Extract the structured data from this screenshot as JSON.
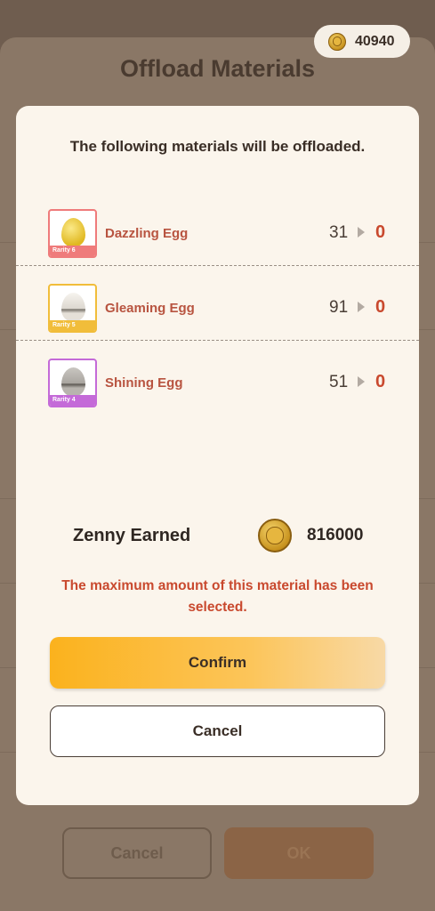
{
  "background": {
    "title": "Offload Materials",
    "cancel_label": "Cancel",
    "ok_label": "OK"
  },
  "wallet": {
    "coins": "40940",
    "icon": "zenny-coin-icon"
  },
  "dialog": {
    "heading": "The following materials will be offloaded.",
    "materials": [
      {
        "name": "Dazzling Egg",
        "rarity": "Rarity 6",
        "from": "31",
        "to": "0",
        "color": "#ef7b7b",
        "egg_color": "#f2d24a"
      },
      {
        "name": "Gleaming Egg",
        "rarity": "Rarity 5",
        "from": "91",
        "to": "0",
        "color": "#f1bd3a",
        "egg_color": "#efeae2"
      },
      {
        "name": "Shining Egg",
        "rarity": "Rarity 4",
        "from": "51",
        "to": "0",
        "color": "#c46ad8",
        "egg_color": "#b5b2ad"
      }
    ],
    "zenny_label": "Zenny Earned",
    "zenny_value": "816000",
    "warning": "The maximum amount of this material has been selected.",
    "confirm_label": "Confirm",
    "cancel_label": "Cancel"
  }
}
